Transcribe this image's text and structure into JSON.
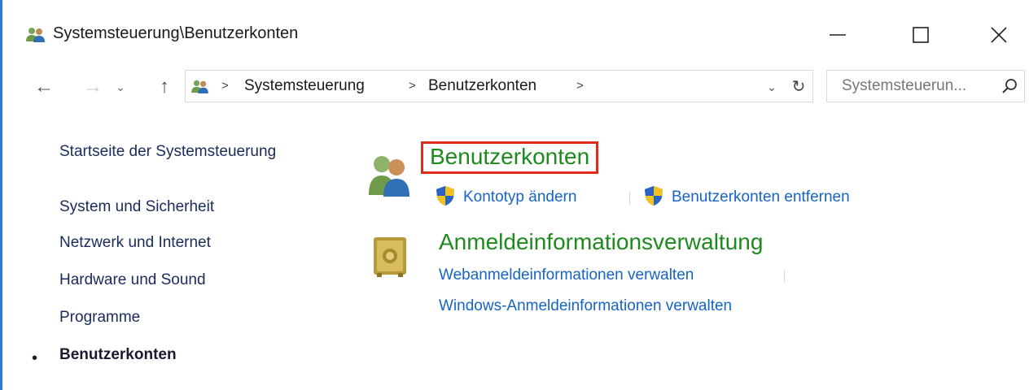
{
  "window": {
    "title": "Systemsteuerung\\Benutzerkonten",
    "controls": {
      "minimize": "minimize",
      "maximize": "maximize",
      "close": "close"
    }
  },
  "address_bar": {
    "breadcrumbs": [
      "Systemsteuerung",
      "Benutzerkonten"
    ],
    "search_placeholder": "Systemsteuerun..."
  },
  "sidebar": {
    "items": [
      {
        "label": "Startseite der Systemsteuerung"
      },
      {
        "label": "System und Sicherheit"
      },
      {
        "label": "Netzwerk und Internet"
      },
      {
        "label": "Hardware und Sound"
      },
      {
        "label": "Programme"
      },
      {
        "label": "Benutzerkonten",
        "active": true
      }
    ]
  },
  "main": {
    "categories": [
      {
        "title": "Benutzerkonten",
        "icon": "users-icon",
        "links": [
          "Kontotyp ändern",
          "Benutzerkonten entfernen"
        ]
      },
      {
        "title": "Anmeldeinformationsverwaltung",
        "icon": "vault-icon",
        "links": [
          "Webanmeldeinformationen verwalten",
          "Windows-Anmeldeinformationen verwalten"
        ]
      }
    ]
  },
  "colors": {
    "accent_border": "#2b7bd6",
    "category_green": "#1e8a1e",
    "link_blue": "#1664c4",
    "highlight_red": "#e02b1b"
  }
}
